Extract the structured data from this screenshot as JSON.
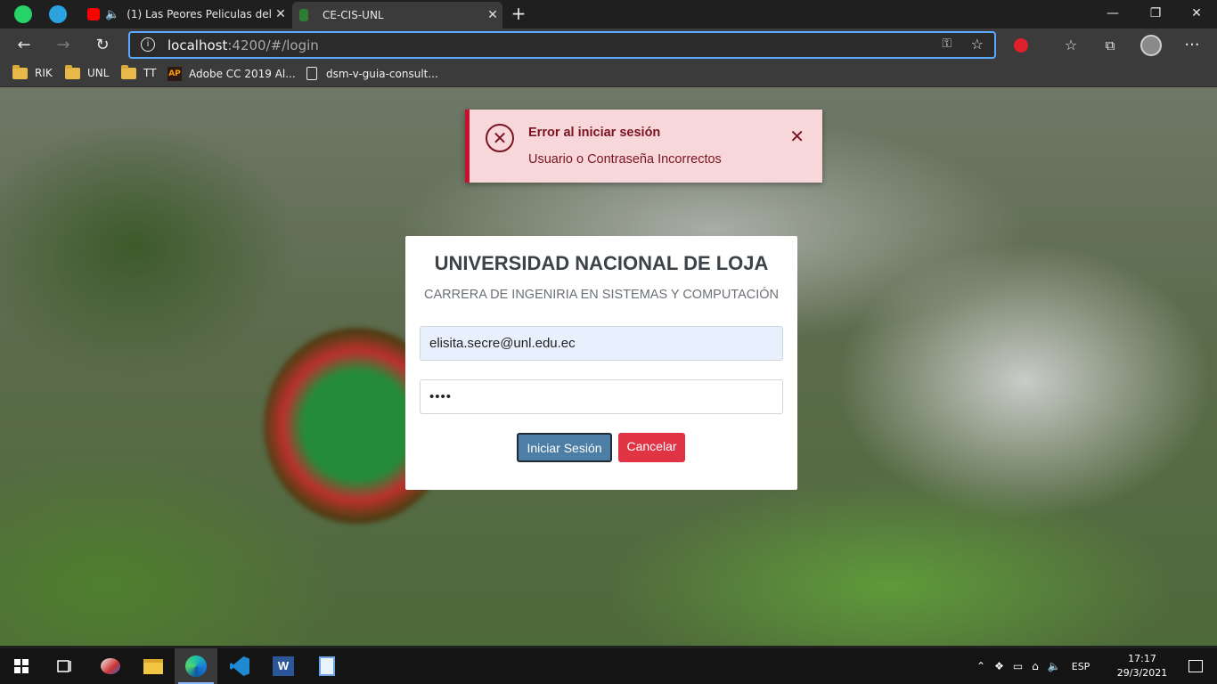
{
  "browser": {
    "tabs": [
      {
        "title": "(1) Las Peores Peliculas del",
        "active": false
      },
      {
        "title": "CE-CIS-UNL",
        "active": true
      }
    ],
    "close_glyph": "✕",
    "new_tab_glyph": "+",
    "window_controls": {
      "minimize": "—",
      "restore": "❐",
      "close": "✕"
    },
    "address": {
      "host": "localhost",
      "rest": ":4200/#/login"
    },
    "bookmarks": [
      "RIK",
      "UNL",
      "TT",
      "Adobe CC 2019 Al...",
      "dsm-v-guia-consult..."
    ],
    "bookmark_ap_badge": "AP",
    "nav": {
      "back": "←",
      "forward": "→",
      "refresh": "↻",
      "info": "i",
      "star": "☆",
      "more": "···"
    }
  },
  "toast": {
    "title": "Error al iniciar sesión",
    "message": "Usuario o Contraseña Incorrectos",
    "icon": "close-circle-icon",
    "color": "#7a1420"
  },
  "login": {
    "title": "UNIVERSIDAD NACIONAL DE LOJA",
    "subtitle": "CARRERA DE INGENIRIA EN SISTEMAS Y COMPUTACIÓN",
    "email_value": "elisita.secre@unl.edu.ec",
    "password_mask": "••••",
    "login_button": "Iniciar Sesión",
    "cancel_button": "Cancelar"
  },
  "taskbar": {
    "language": "ESP",
    "time": "17:17",
    "date": "29/3/2021"
  },
  "colors": {
    "accent": "#5aa9ff",
    "login_button": "#4d7fa6",
    "cancel_button": "#e03344",
    "toast_bg": "#f8d7da"
  }
}
